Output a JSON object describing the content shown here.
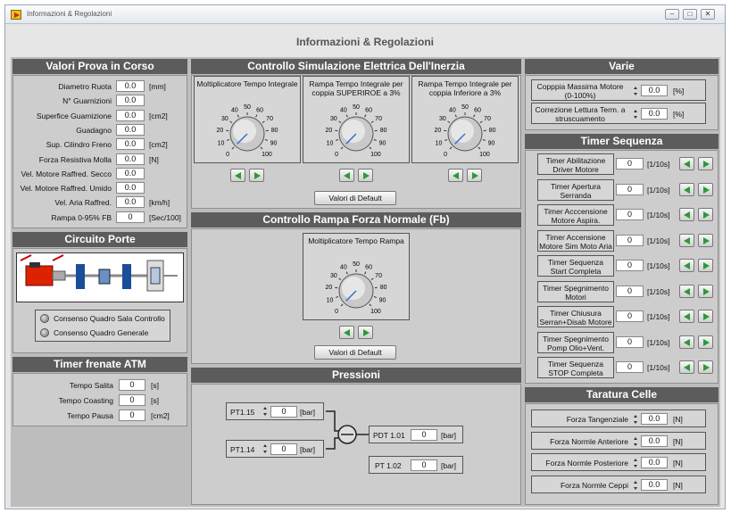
{
  "window": {
    "title": "Informazioni & Regolazioni",
    "minimize": "–",
    "maximize": "□",
    "close": "✕"
  },
  "header": {
    "title": "Informazioni & Regolazioni"
  },
  "valori": {
    "title": "Valori Prova in Corso",
    "rows": [
      {
        "label": "Diametro Ruota",
        "value": "0.0",
        "unit": "[mm]"
      },
      {
        "label": "N° Guarnizioni",
        "value": "0.0",
        "unit": ""
      },
      {
        "label": "Superfice Guarnizione",
        "value": "0.0",
        "unit": "[cm2]"
      },
      {
        "label": "Guadagno",
        "value": "0.0",
        "unit": ""
      },
      {
        "label": "Sup. Cilindro Freno",
        "value": "0.0",
        "unit": "[cm2]"
      },
      {
        "label": "Forza Resistiva Molla",
        "value": "0.0",
        "unit": "[N]"
      },
      {
        "label": "Vel. Motore Raffred. Secco",
        "value": "0.0",
        "unit": ""
      },
      {
        "label": "Vel. Motore Raffred. Umido",
        "value": "0.0",
        "unit": ""
      },
      {
        "label": "Vel. Aria Raffred.",
        "value": "0.0",
        "unit": "[km/h]"
      },
      {
        "label": "Rampa 0-95% FB",
        "value": "0",
        "unit": "[Sec/100]"
      }
    ]
  },
  "circuito": {
    "title": "Circuito Porte",
    "leds": [
      "Consenso Quadro Sala Controllo",
      "Consenso Quadro Generale"
    ]
  },
  "timer_frenate": {
    "title": "Timer frenate ATM",
    "rows": [
      {
        "label": "Tempo Salita",
        "value": "0",
        "unit": "[s]"
      },
      {
        "label": "Tempo Coasting",
        "value": "0",
        "unit": "[s]"
      },
      {
        "label": "Tempo Pausa",
        "value": "0",
        "unit": "[cm2]"
      }
    ]
  },
  "sim_inerzia": {
    "title": "Controllo Simulazione Elettrica Dell'Inerzia",
    "knobs": [
      {
        "label": "Moltiplicatore Tempo Integrale"
      },
      {
        "label": "Rampa Tempo Integrale per coppia SUPERIROE a 3%"
      },
      {
        "label": "Rampa Tempo Integrale per coppia Inferiore a 3%"
      }
    ],
    "default_button": "Valori di Default"
  },
  "knob_scale": [
    "0",
    "10",
    "20",
    "30",
    "40",
    "50",
    "60",
    "70",
    "80",
    "90",
    "100"
  ],
  "rampa_fb": {
    "title": "Controllo Rampa Forza Normale (Fb)",
    "knob": {
      "label": "Moltiplicatore Tempo Rampa"
    },
    "default_button": "Valori di Default"
  },
  "pressioni": {
    "title": "Pressioni",
    "pt115": {
      "label": "PT1.15",
      "value": "0",
      "unit": "[bar]"
    },
    "pt114": {
      "label": "PT1.14",
      "value": "0",
      "unit": "[bar]"
    },
    "pdt101": {
      "label": "PDT 1.01",
      "value": "0",
      "unit": "[bar]"
    },
    "pt102": {
      "label": "PT 1.02",
      "value": "0",
      "unit": "[bar]"
    }
  },
  "varie": {
    "title": "Varie",
    "rows": [
      {
        "label": "Copppia Massima Motore (0-100%)",
        "value": "0.0",
        "unit": "[%]"
      },
      {
        "label": "Correzione Lettura Term. a struscuamento",
        "value": "0.0",
        "unit": "[%]"
      }
    ]
  },
  "timer_seq": {
    "title": "Timer Sequenza",
    "rows": [
      {
        "label": "Timer Abilitazione Driver Motore",
        "value": "0",
        "unit": "[1/10s]"
      },
      {
        "label": "Timer Apertura Serranda",
        "value": "0",
        "unit": "[1/10s]"
      },
      {
        "label": "Timer Acccensione Motore Aspira.",
        "value": "0",
        "unit": "[1/10s]"
      },
      {
        "label": "Timer Accensione Motore Sim Moto Aria",
        "value": "0",
        "unit": "[1/10s]"
      },
      {
        "label": "Timer Sequenza Start Completa",
        "value": "0",
        "unit": "[1/10s]"
      },
      {
        "label": "Timer Spegnimento Motori",
        "value": "0",
        "unit": "[1/10s]"
      },
      {
        "label": "Timer Chiusura Serran+Disab Motore",
        "value": "0",
        "unit": "[1/10s]"
      },
      {
        "label": "Timer Spegnimento Pomp Olio+Vent.",
        "value": "0",
        "unit": "[1/10s]"
      },
      {
        "label": "Timer Sequenza STOP Completa",
        "value": "0",
        "unit": "[1/10s]"
      }
    ]
  },
  "taratura": {
    "title": "Taratura Celle",
    "rows": [
      {
        "label": "Forza Tangenziale",
        "value": "0.0",
        "unit": "[N]"
      },
      {
        "label": "Forza Normle Anteriore",
        "value": "0.0",
        "unit": "[N]"
      },
      {
        "label": "Forza Normle Posteriore",
        "value": "0.0",
        "unit": "[N]"
      },
      {
        "label": "Forza Normle Ceppi",
        "value": "0.0",
        "unit": "[N]"
      }
    ]
  }
}
